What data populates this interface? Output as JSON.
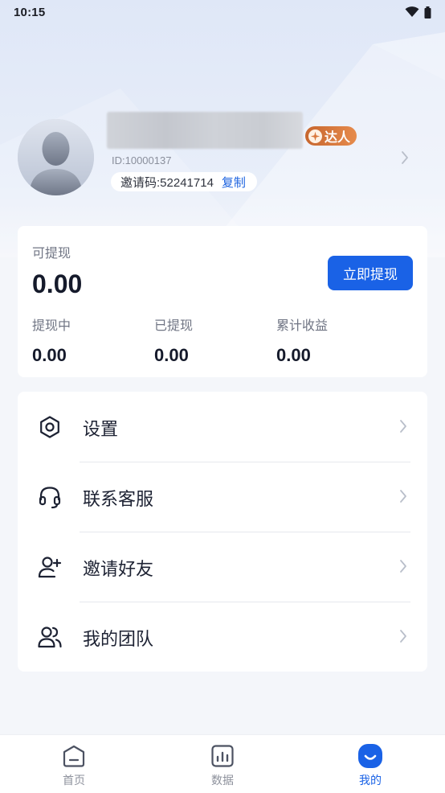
{
  "status_bar": {
    "time": "10:15"
  },
  "profile": {
    "badge_label": "达人",
    "id_text": "ID:10000137",
    "invite_text": "邀请码:52241714",
    "copy_label": "复制"
  },
  "balance": {
    "available_label": "可提现",
    "available_value": "0.00",
    "withdraw_button": "立即提现",
    "stats": [
      {
        "label": "提现中",
        "value": "0.00"
      },
      {
        "label": "已提现",
        "value": "0.00"
      },
      {
        "label": "累计收益",
        "value": "0.00"
      }
    ]
  },
  "menu": {
    "items": [
      {
        "label": "设置",
        "icon": "gear-icon"
      },
      {
        "label": "联系客服",
        "icon": "headset-icon"
      },
      {
        "label": "邀请好友",
        "icon": "add-user-icon"
      },
      {
        "label": "我的团队",
        "icon": "team-icon"
      }
    ]
  },
  "bottom_nav": {
    "items": [
      {
        "label": "首页",
        "icon": "home-icon",
        "active": false
      },
      {
        "label": "数据",
        "icon": "chart-icon",
        "active": false
      },
      {
        "label": "我的",
        "icon": "profile-icon",
        "active": true
      }
    ],
    "accent": "#1a62e6"
  },
  "colors": {
    "primary": "#1a62e6",
    "badge": "#d9773c",
    "text": "#1d2233",
    "muted": "#707584"
  }
}
